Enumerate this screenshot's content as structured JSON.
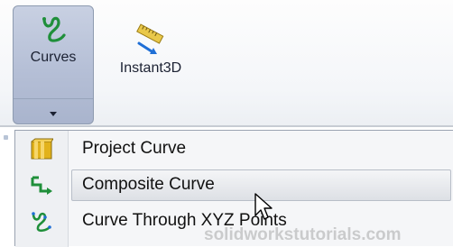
{
  "ribbon": {
    "curves": {
      "label": "Curves",
      "icon": "curves-icon"
    },
    "instant3d": {
      "label": "Instant3D",
      "icon": "instant3d-icon"
    }
  },
  "menu": {
    "items": [
      {
        "label": "Project Curve",
        "icon": "project-curve-icon"
      },
      {
        "label": "Composite Curve",
        "icon": "composite-curve-icon",
        "state": "hover"
      },
      {
        "label": "Curve Through XYZ Points",
        "icon": "curve-xyz-icon"
      }
    ]
  },
  "watermark": "solidworkstutorials.com",
  "colors": {
    "ribbon_button_active": "#b5bfd6",
    "menu_background": "#f5f6f8",
    "icon_green": "#1f8f3a",
    "icon_yellow": "#e2b21b"
  }
}
